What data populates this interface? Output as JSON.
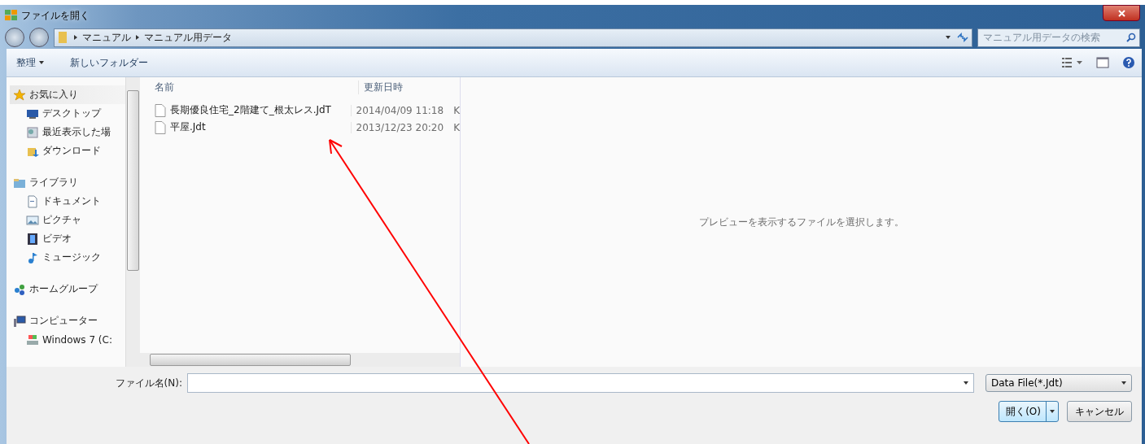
{
  "window": {
    "title": "ファイルを開く"
  },
  "address_bar": {
    "path": [
      {
        "label": "マニュアル"
      },
      {
        "label": "マニュアル用データ"
      }
    ]
  },
  "search": {
    "placeholder": "マニュアル用データの検索"
  },
  "toolbar": {
    "items": [
      {
        "label": "整理",
        "dropdown": true
      },
      {
        "label": "新しいフォルダー",
        "dropdown": false
      }
    ]
  },
  "sidebar": {
    "groups": [
      {
        "label": "お気に入り",
        "kind": "star",
        "selected": true,
        "items": [
          {
            "label": "デスクトップ",
            "kind": "desktop"
          },
          {
            "label": "最近表示した場",
            "kind": "recent"
          },
          {
            "label": "ダウンロード",
            "kind": "download"
          }
        ]
      },
      {
        "label": "ライブラリ",
        "kind": "library",
        "selected": false,
        "items": [
          {
            "label": "ドキュメント",
            "kind": "document"
          },
          {
            "label": "ピクチャ",
            "kind": "picture"
          },
          {
            "label": "ビデオ",
            "kind": "video"
          },
          {
            "label": "ミュージック",
            "kind": "music"
          }
        ]
      },
      {
        "label": "ホームグループ",
        "kind": "homegroup",
        "selected": false
      },
      {
        "label": "コンピューター",
        "kind": "computer",
        "selected": false,
        "items": [
          {
            "label": "Windows 7 (C:",
            "kind": "drive"
          }
        ]
      }
    ]
  },
  "file_list": {
    "columns": [
      "名前",
      "更新日時"
    ],
    "rows": [
      {
        "name": "長期優良住宅_2階建て_根太レス.JdT",
        "modified": "2014/04/09 11:18",
        "column_3": "K"
      },
      {
        "name": "平屋.Jdt",
        "modified": "2013/12/23 20:20",
        "column_3": "K"
      }
    ]
  },
  "preview": {
    "message": "プレビューを表示するファイルを選択します。"
  },
  "footer": {
    "filename_label": "ファイル名(N):",
    "file_type": "Data File(*.Jdt)",
    "open_button": "開く(O)",
    "cancel_button": "キャンセル"
  }
}
